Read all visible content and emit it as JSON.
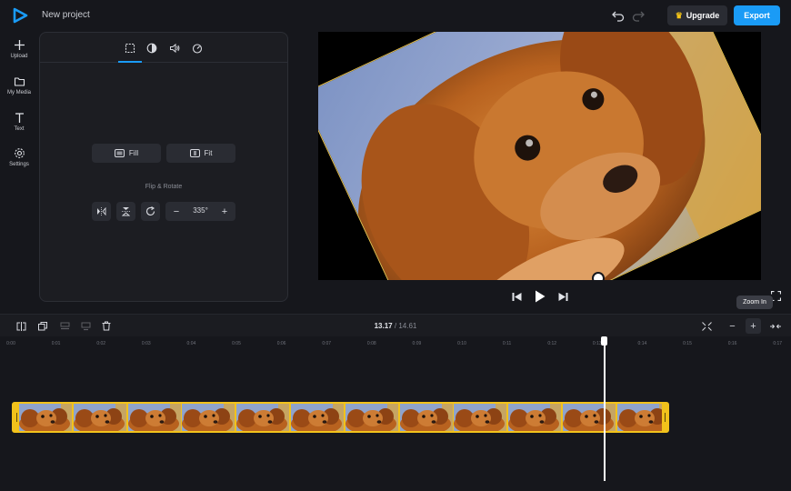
{
  "app": {
    "project_title": "New project",
    "upgrade_label": "Upgrade",
    "export_label": "Export",
    "accent_color": "#1a9bf6",
    "icons": [
      "logo-icon",
      "undo-icon",
      "redo-icon",
      "crown-icon"
    ]
  },
  "sidebar": {
    "items": [
      {
        "label": "Upload",
        "icon": "plus-icon"
      },
      {
        "label": "My Media",
        "icon": "folder-icon"
      },
      {
        "label": "Text",
        "icon": "text-icon"
      },
      {
        "label": "Settings",
        "icon": "gear-icon"
      }
    ]
  },
  "properties": {
    "tabs": [
      "transform-icon",
      "adjust-icon",
      "audio-icon",
      "speed-icon"
    ],
    "active_tab": "transform-icon",
    "fill_label": "Fill",
    "fit_label": "Fit",
    "flip_rotate_label": "Flip & Rotate",
    "rotation_value": "335°"
  },
  "preview": {
    "rotation_degrees": -25,
    "image_subject": "brown dog lying on a blue chair"
  },
  "player": {
    "controls": [
      "skip-back-icon",
      "play-icon",
      "skip-forward-icon"
    ]
  },
  "timeline": {
    "current_time": "13.17",
    "separator": "/",
    "total_time": "14.61",
    "tooltip": "Zoom In",
    "ticks": [
      "0:00",
      "0:01",
      "0:02",
      "0:03",
      "0:04",
      "0:05",
      "0:06",
      "0:07",
      "0:08",
      "0:09",
      "0:10",
      "0:11",
      "0:12",
      "0:13",
      "0:14",
      "0:15",
      "0:16",
      "0:17"
    ],
    "clip_color": "#f2c21b",
    "clip_frames": 12
  }
}
